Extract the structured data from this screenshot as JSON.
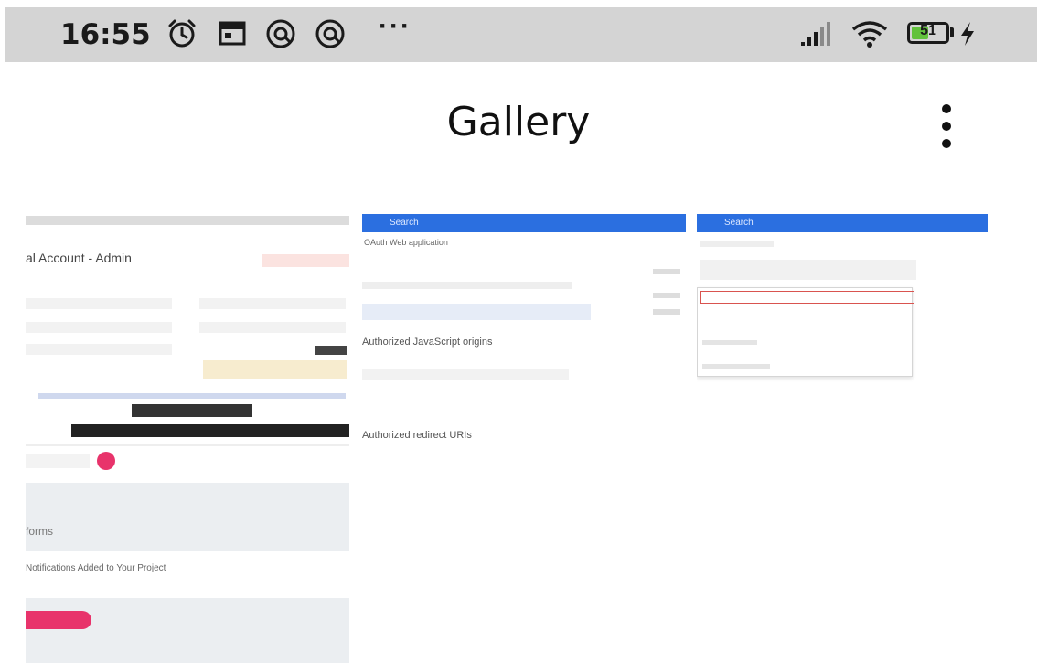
{
  "status_bar": {
    "time": "16:55",
    "more_indicator": "···",
    "battery_level": "51",
    "battery_percent": 51,
    "icons": [
      "alarm-icon",
      "calendar-icon",
      "vpn-icon",
      "vpn-icon",
      "signal-icon",
      "wifi-icon",
      "battery-icon",
      "charging-icon"
    ]
  },
  "app_bar": {
    "title": "Gallery",
    "menu_icon": "more-vert-icon"
  },
  "tiles": [
    {
      "name": "screenshot-1",
      "heading": "al Account - Admin",
      "subheading": "forms",
      "subheading2": "Notifications Added to Your Project"
    },
    {
      "name": "screenshot-2",
      "search": "Search",
      "heading": "OAuth Web application",
      "section1": "Authorized JavaScript origins",
      "section2": "Authorized redirect URIs"
    },
    {
      "name": "screenshot-3",
      "search": "Search"
    }
  ],
  "colors": {
    "status_bg": "#d4d4d4",
    "accent_blue": "#2b6fe0",
    "pink": "#e8336b",
    "battery": "#62c23c"
  }
}
